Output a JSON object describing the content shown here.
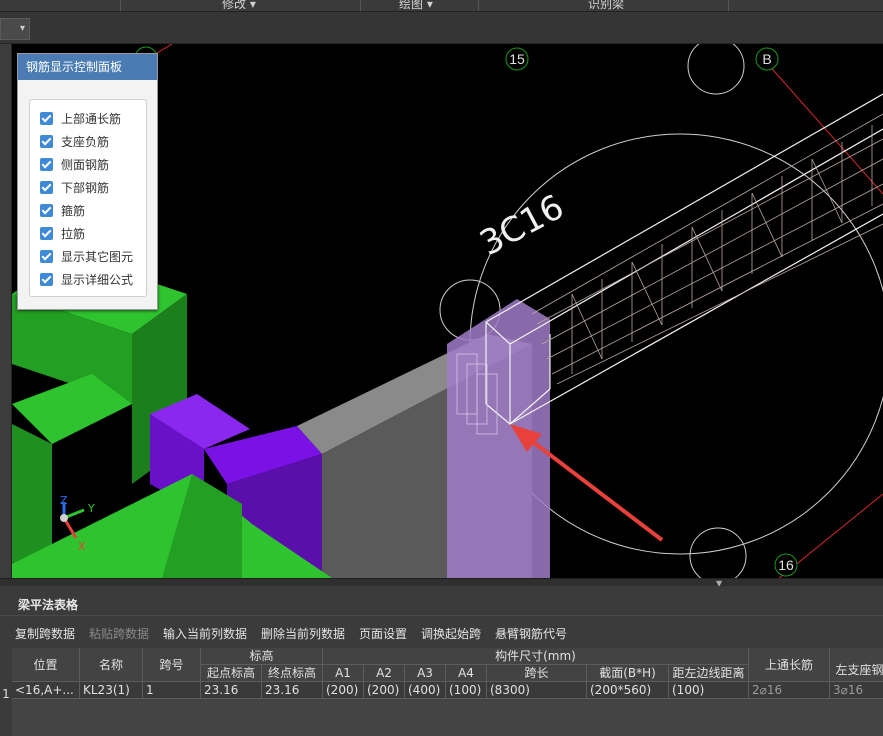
{
  "menu": {
    "items": [
      {
        "label": "修改 ▾"
      },
      {
        "label": "绘图 ▾"
      },
      {
        "label": "识别梁"
      }
    ]
  },
  "panel": {
    "title": "钢筋显示控制面板",
    "options": [
      {
        "label": "上部通长筋",
        "checked": true
      },
      {
        "label": "支座负筋",
        "checked": true
      },
      {
        "label": "侧面钢筋",
        "checked": true
      },
      {
        "label": "下部钢筋",
        "checked": true
      },
      {
        "label": "箍筋",
        "checked": true
      },
      {
        "label": "拉筋",
        "checked": true
      },
      {
        "label": "显示其它图元",
        "checked": true
      },
      {
        "label": "显示详细公式",
        "checked": true
      }
    ]
  },
  "viewport": {
    "axis_labels": [
      "15",
      "B",
      "16"
    ],
    "rebar_label": "3C16",
    "axes": {
      "x": "X",
      "y": "Y",
      "z": "Z"
    },
    "colors": {
      "beam_green": "#2fc42f",
      "column_purple": "#7a12e6",
      "arrow_red": "#e8403a"
    }
  },
  "table": {
    "title": "梁平法表格",
    "toolbar": [
      {
        "label": "复制跨数据",
        "enabled": true
      },
      {
        "label": "粘贴跨数据",
        "enabled": false
      },
      {
        "label": "输入当前列数据",
        "enabled": true
      },
      {
        "label": "删除当前列数据",
        "enabled": true
      },
      {
        "label": "页面设置",
        "enabled": true
      },
      {
        "label": "调换起始跨",
        "enabled": true
      },
      {
        "label": "悬臂钢筋代号",
        "enabled": true
      }
    ],
    "header": {
      "position": "位置",
      "name": "名称",
      "span": "跨号",
      "elevation": "标高",
      "start_elev": "起点标高",
      "end_elev": "终点标高",
      "dimensions": "构件尺寸(mm)",
      "a1": "A1",
      "a2": "A2",
      "a3": "A3",
      "a4": "A4",
      "span_len": "跨长",
      "section": "截面(B*H)",
      "edge_dist": "距左边线距离",
      "top_long": "上通长筋",
      "left_support": "左支座钢"
    },
    "rows": [
      {
        "index": "1",
        "position": "<16,A+...",
        "name": "KL23(1)",
        "span": "1",
        "start_elev": "23.16",
        "end_elev": "23.16",
        "a1": "(200)",
        "a2": "(200)",
        "a3": "(400)",
        "a4": "(100)",
        "span_len": "(8300)",
        "section": "(200*560)",
        "edge_dist": "(100)",
        "top_long": "2⌀16",
        "left_support": "3⌀16"
      }
    ]
  }
}
